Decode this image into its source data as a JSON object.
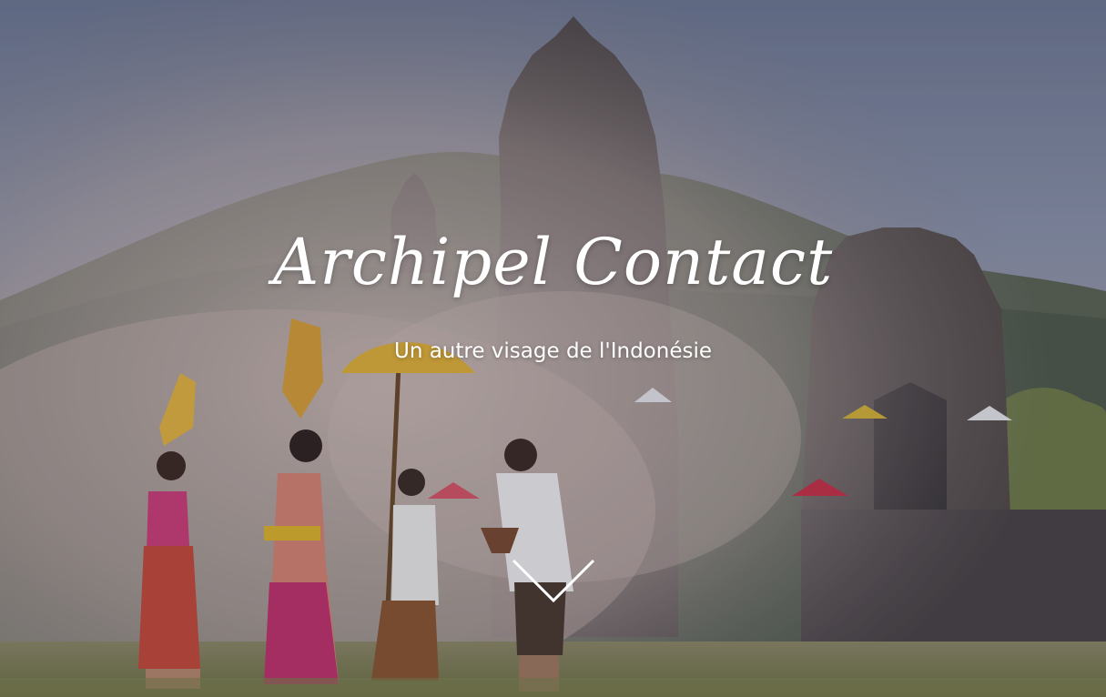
{
  "hero": {
    "title": "Archipel Contact",
    "subtitle": "Un autre visage de l'Indonésie",
    "scroll_icon": "chevron-down-icon"
  },
  "colors": {
    "text": "#ffffff",
    "sky": "#8e98ad",
    "mist": "#b9adad",
    "grass": "#9a9a5c"
  }
}
